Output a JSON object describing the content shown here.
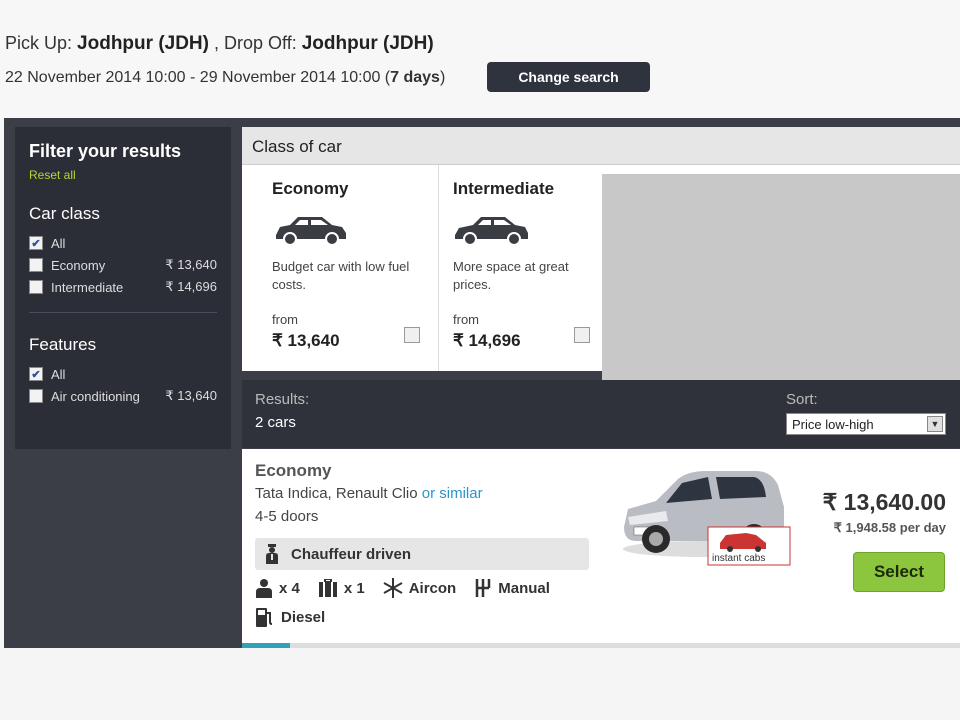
{
  "search": {
    "pickup_label": "Pick Up:",
    "pickup_value": "Jodhpur (JDH)",
    "dropoff_label": ", Drop Off:",
    "dropoff_value": "Jodhpur (JDH)",
    "dates": "22 November 2014 10:00 - 29 November 2014 10:00 (",
    "duration": "7 days",
    "dates_close": ")",
    "change_button": "Change search"
  },
  "filters": {
    "title": "Filter your results",
    "reset": "Reset all",
    "car_class_title": "Car class",
    "car_class_items": [
      {
        "label": "All",
        "price": "",
        "checked": true
      },
      {
        "label": "Economy",
        "price": "₹ 13,640",
        "checked": false
      },
      {
        "label": "Intermediate",
        "price": "₹ 14,696",
        "checked": false
      }
    ],
    "features_title": "Features",
    "feature_items": [
      {
        "label": "All",
        "price": "",
        "checked": true
      },
      {
        "label": "Air conditioning",
        "price": "₹ 13,640",
        "checked": false
      }
    ]
  },
  "class_of_car": {
    "heading": "Class of car",
    "cards": [
      {
        "title": "Economy",
        "desc": "Budget car with low fuel costs.",
        "from": "from",
        "price": "₹ 13,640"
      },
      {
        "title": "Intermediate",
        "desc": "More space at great prices.",
        "from": "from",
        "price": "₹ 14,696"
      }
    ]
  },
  "results": {
    "label": "Results:",
    "count": "2 cars",
    "sort_label": "Sort:",
    "sort_value": "Price low-high"
  },
  "result_item": {
    "class": "Economy",
    "models": "Tata Indica, Renault Clio",
    "or_similar": "or similar",
    "doors": "4-5 doors",
    "chauffeur": "Chauffeur driven",
    "passengers": "x 4",
    "bags": "x 1",
    "aircon": "Aircon",
    "transmission": "Manual",
    "fuel": "Diesel",
    "price": "₹ 13,640.00",
    "price_per_day": "₹ 1,948.58 per day",
    "select_button": "Select",
    "supplier_logo_text": "instant cabs"
  },
  "colors": {
    "accent_green": "#8cc63f",
    "link_blue": "#2b95c9",
    "dark_panel": "#2b2e36"
  }
}
